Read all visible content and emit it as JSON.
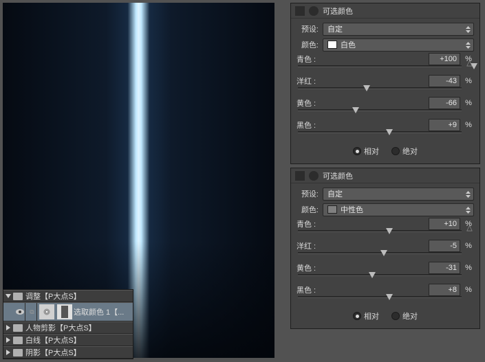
{
  "panel_title": "可选颜色",
  "preset_label": "预设:",
  "color_label": "颜色:",
  "panels": [
    {
      "preset_value": "自定",
      "color_value": "白色",
      "swatch": "#ffffff",
      "sliders": {
        "cyan": {
          "label": "青色 :",
          "value": "+100"
        },
        "magenta": {
          "label": "洋红 :",
          "value": "-43"
        },
        "yellow": {
          "label": "黄色 :",
          "value": "-66"
        },
        "black": {
          "label": "黑色 :",
          "value": "+9"
        }
      },
      "method": {
        "relative": "相对",
        "absolute": "绝对",
        "selected": "relative"
      }
    },
    {
      "preset_value": "自定",
      "color_value": "中性色",
      "swatch": "#808080",
      "sliders": {
        "cyan": {
          "label": "青色 :",
          "value": "+10"
        },
        "magenta": {
          "label": "洋红 :",
          "value": "-5"
        },
        "yellow": {
          "label": "黄色 :",
          "value": "-31"
        },
        "black": {
          "label": "黑色 :",
          "value": "+8"
        }
      },
      "method": {
        "relative": "相对",
        "absolute": "绝对",
        "selected": "relative"
      }
    }
  ],
  "pct": "%",
  "layers": {
    "group_open": "调整【P大点S】",
    "active": "选取颜色 1【...",
    "closed_1": "人物剪影【P大点S】",
    "closed_2": "白线【P大点S】",
    "closed_3": "阴影【P大点S】"
  },
  "slider_pos": {
    "p0_cyan": 100,
    "p0_magenta": 39,
    "p0_yellow": 33,
    "p0_black": 52,
    "p1_cyan": 52,
    "p1_magenta": 49,
    "p1_yellow": 42,
    "p1_black": 52
  }
}
